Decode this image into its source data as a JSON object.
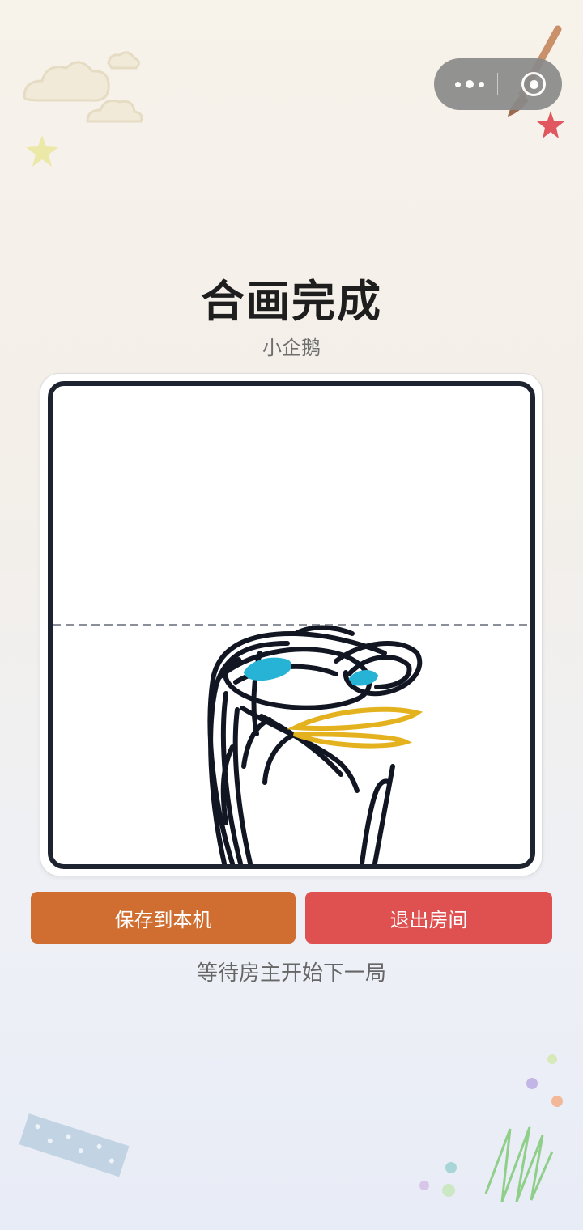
{
  "page": {
    "title": "合画完成",
    "subtitle": "小企鹅"
  },
  "actions": {
    "save_label": "保存到本机",
    "exit_label": "退出房间"
  },
  "status_text": "等待房主开始下一局",
  "capsule": {
    "more_icon": "more-dots-icon",
    "close_icon": "mini-program-close-icon"
  },
  "colors": {
    "save_button": "#cf6e30",
    "exit_button": "#df5150",
    "canvas_border": "#1e2330",
    "ink_black": "#111622",
    "ink_blue": "#27b3d6",
    "ink_yellow": "#e4b21e"
  }
}
